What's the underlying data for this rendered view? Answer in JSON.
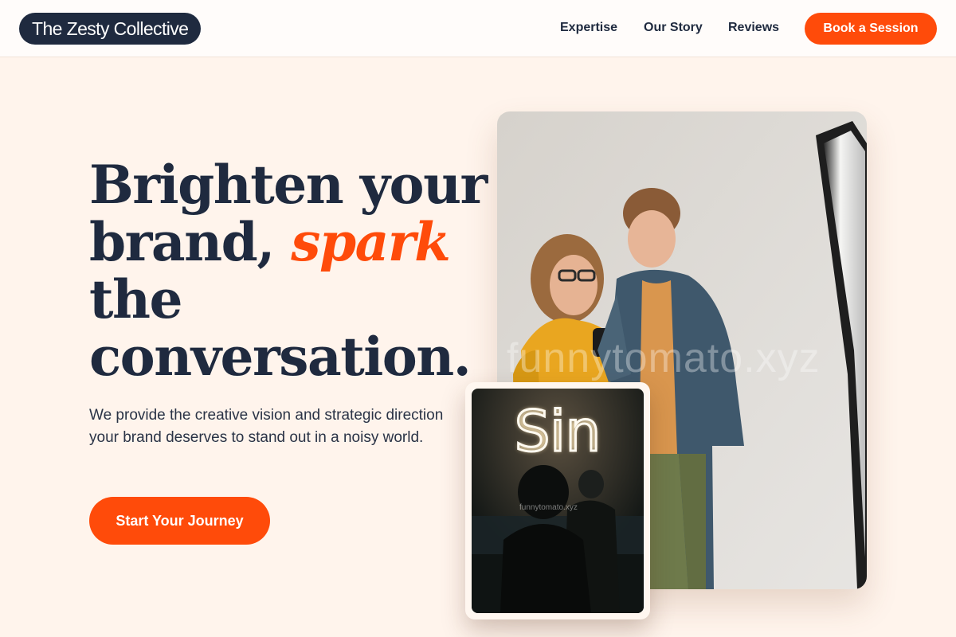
{
  "header": {
    "brand": "The Zesty Collective",
    "nav": [
      "Expertise",
      "Our Story",
      "Reviews"
    ],
    "cta": "Book a Session"
  },
  "hero": {
    "headline_line1": "Brighten your",
    "headline_line2_start": "brand, ",
    "headline_accent": "spark",
    "headline_line3": "the",
    "headline_line4": "conversation.",
    "subtext": "We provide the creative vision and strategic direction your brand deserves to stand out in a noisy world.",
    "cta": "Start Your Journey"
  },
  "images": {
    "main_watermark": "funnytomato.xyz",
    "small_watermark": "funnytomato.xyz",
    "neon_text": "Sin"
  },
  "colors": {
    "accent": "#ff4b0a",
    "navy": "#1f2a3f",
    "background": "#fff4ec"
  }
}
